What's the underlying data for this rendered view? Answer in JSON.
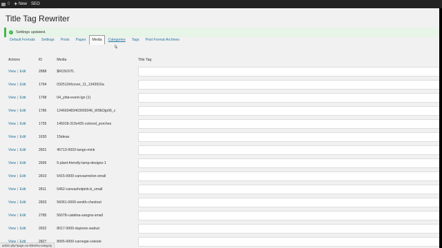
{
  "adminbar": {
    "comments_count": "0",
    "new_label": "New",
    "seo_label": "SEO"
  },
  "page": {
    "title": "Title Tag Rewriter"
  },
  "notice": {
    "text": "Settings updated."
  },
  "tabs": [
    {
      "label": "Default Formats"
    },
    {
      "label": "Settings"
    },
    {
      "label": "Posts"
    },
    {
      "label": "Pages"
    },
    {
      "label": "Media"
    },
    {
      "label": "Categories"
    },
    {
      "label": "Tags"
    },
    {
      "label": "Post Format Archives"
    }
  ],
  "table": {
    "headers": {
      "actions": "Actions",
      "id": "ID",
      "media": "Media",
      "title_tag": "Title Tag"
    },
    "view_label": "View",
    "edit_label": "Edit",
    "rows": [
      {
        "id": "2888",
        "media": "$ROSOITL"
      },
      {
        "id": "1794",
        "media": "032512hfcover_11_1343916a"
      },
      {
        "id": "1798",
        "media": "04_yifat-event-lgn (1)"
      },
      {
        "id": "1786",
        "media": "124693483403009346_W9EDjp06_c"
      },
      {
        "id": "1735",
        "media": "145018-319x425-colored_porches"
      },
      {
        "id": "1630",
        "media": "15ideas"
      },
      {
        "id": "2831",
        "media": "45713-0003-tango-mink"
      },
      {
        "id": "2695",
        "media": "5-plant-friendly-lamp-designs-1"
      },
      {
        "id": "2810",
        "media": "5415-0000-canvasmelon-small"
      },
      {
        "id": "2811",
        "media": "5462-canvashotpink-b_small"
      },
      {
        "id": "2833",
        "media": "56061-0000-zenith-chestnut"
      },
      {
        "id": "2785",
        "media": "56078-catalina-sangria-small"
      },
      {
        "id": "2832",
        "media": "8017-0000-dupione-walnut"
      },
      {
        "id": "2827",
        "media": "8065-0000-carnegie-celeste"
      }
    ]
  },
  "statusbar": {
    "url": "admin.php?page=su-titles#su-category"
  },
  "colors": {
    "adminbar": "#222222",
    "link": "#21759b",
    "notice_border": "#46b450",
    "background": "#f1f1f1"
  }
}
